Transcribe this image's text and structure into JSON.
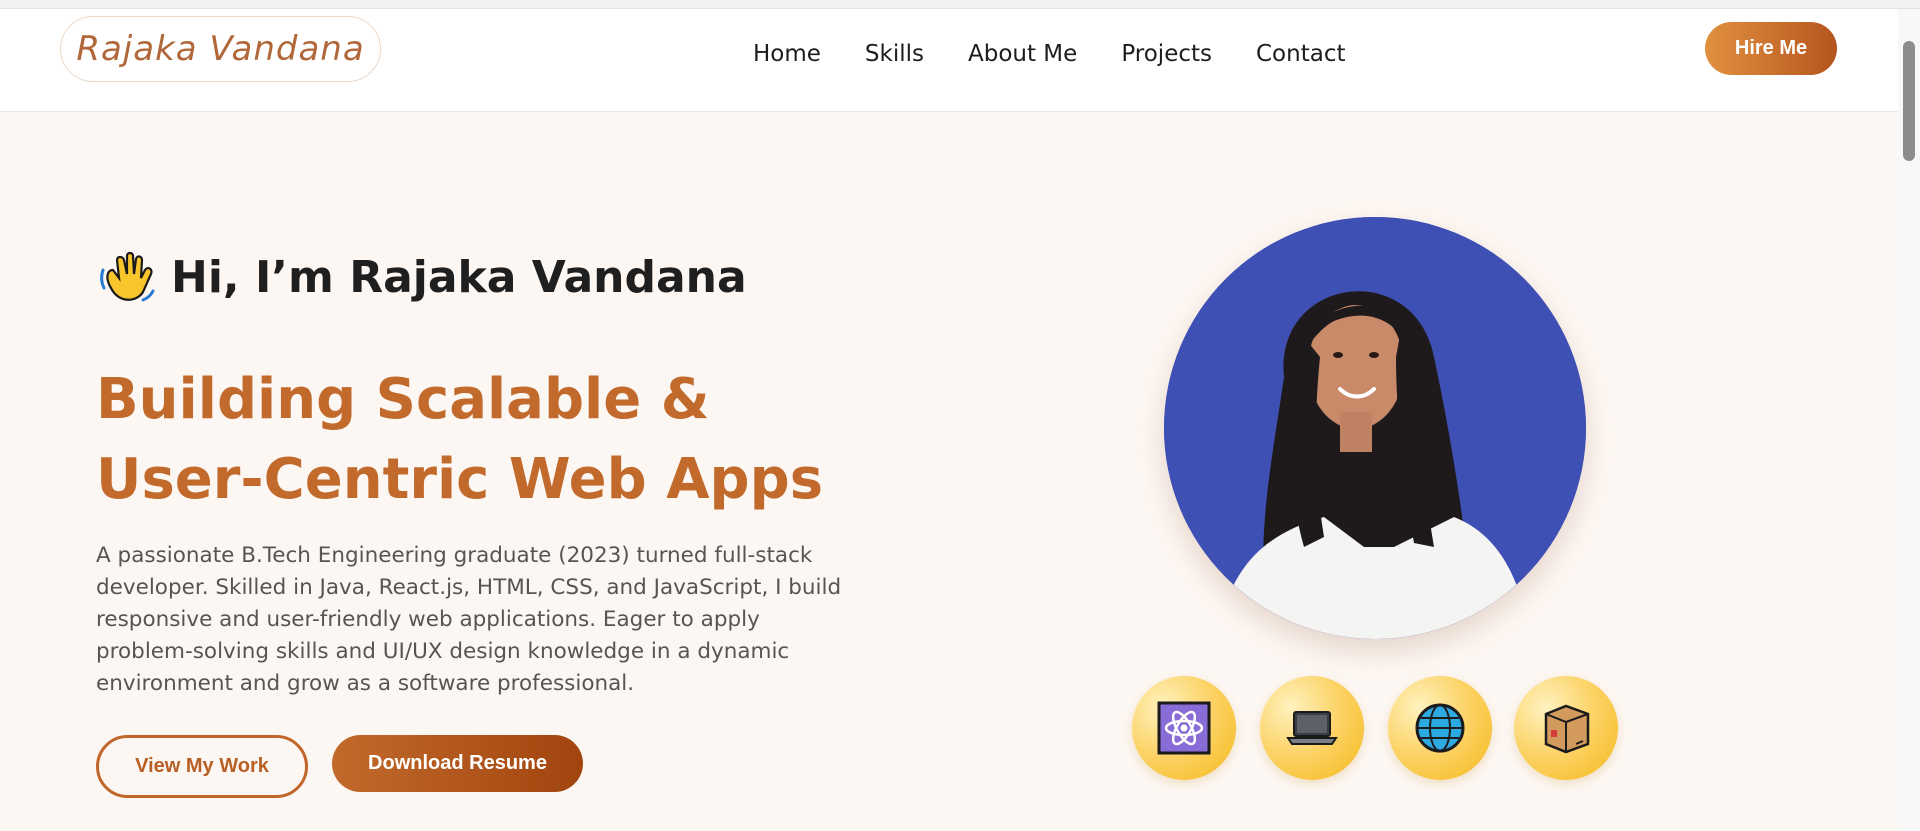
{
  "header": {
    "logo": "Rajaka Vandana",
    "nav": [
      "Home",
      "Skills",
      "About Me",
      "Projects",
      "Contact"
    ],
    "hire_label": "Hire Me"
  },
  "hero": {
    "greeting": "Hi, I’m Rajaka Vandana",
    "headline": "Building Scalable & User-Centric Web Apps",
    "description": "A passionate B.Tech Engineering graduate (2023) turned full-stack developer. Skilled in Java, React.js, HTML, CSS, and JavaScript, I build responsive and user-friendly web applications. Eager to apply problem-solving skills and UI/UX design knowledge in a dynamic environment and grow as a software professional.",
    "view_work_label": "View My Work",
    "download_label": "Download Resume",
    "tech_icons": [
      "atom-icon",
      "laptop-icon",
      "globe-icon",
      "package-icon"
    ]
  },
  "colors": {
    "accent": "#c26a2c",
    "portrait_bg": "#3f50b5",
    "hero_bg": "#fdf7f3"
  }
}
